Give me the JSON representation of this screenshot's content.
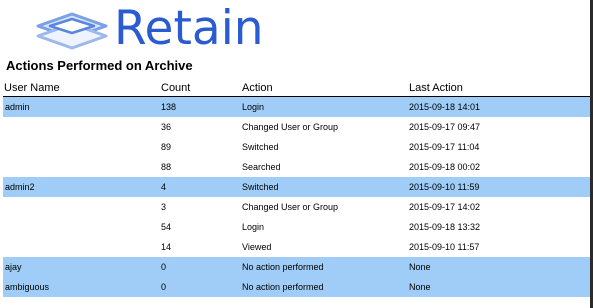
{
  "brand": {
    "name": "Retain",
    "color": "#2a5bd0"
  },
  "report": {
    "title": "Actions Performed on Archive",
    "columns": {
      "user": "User Name",
      "count": "Count",
      "action": "Action",
      "last": "Last Action"
    },
    "rows": [
      {
        "user": "admin",
        "count": "138",
        "action": "Login",
        "last": "2015-09-18 14:01",
        "group": true
      },
      {
        "user": "",
        "count": "36",
        "action": "Changed User or Group",
        "last": "2015-09-17 09:47",
        "group": false
      },
      {
        "user": "",
        "count": "89",
        "action": "Switched",
        "last": "2015-09-17 11:04",
        "group": false
      },
      {
        "user": "",
        "count": "88",
        "action": "Searched",
        "last": "2015-09-18 00:02",
        "group": false
      },
      {
        "user": "admin2",
        "count": "4",
        "action": "Switched",
        "last": "2015-09-10 11:59",
        "group": true
      },
      {
        "user": "",
        "count": "3",
        "action": "Changed User or Group",
        "last": "2015-09-17 14:02",
        "group": false
      },
      {
        "user": "",
        "count": "54",
        "action": "Login",
        "last": "2015-09-18 13:32",
        "group": false
      },
      {
        "user": "",
        "count": "14",
        "action": "Viewed",
        "last": "2015-09-10 11:57",
        "group": false
      },
      {
        "user": "ajay",
        "count": "0",
        "action": "No action performed",
        "last": "None",
        "group": true
      },
      {
        "user": "ambiguous",
        "count": "0",
        "action": "No action performed",
        "last": "None",
        "group": true
      }
    ],
    "group_row_color": "#9fcdf7"
  }
}
